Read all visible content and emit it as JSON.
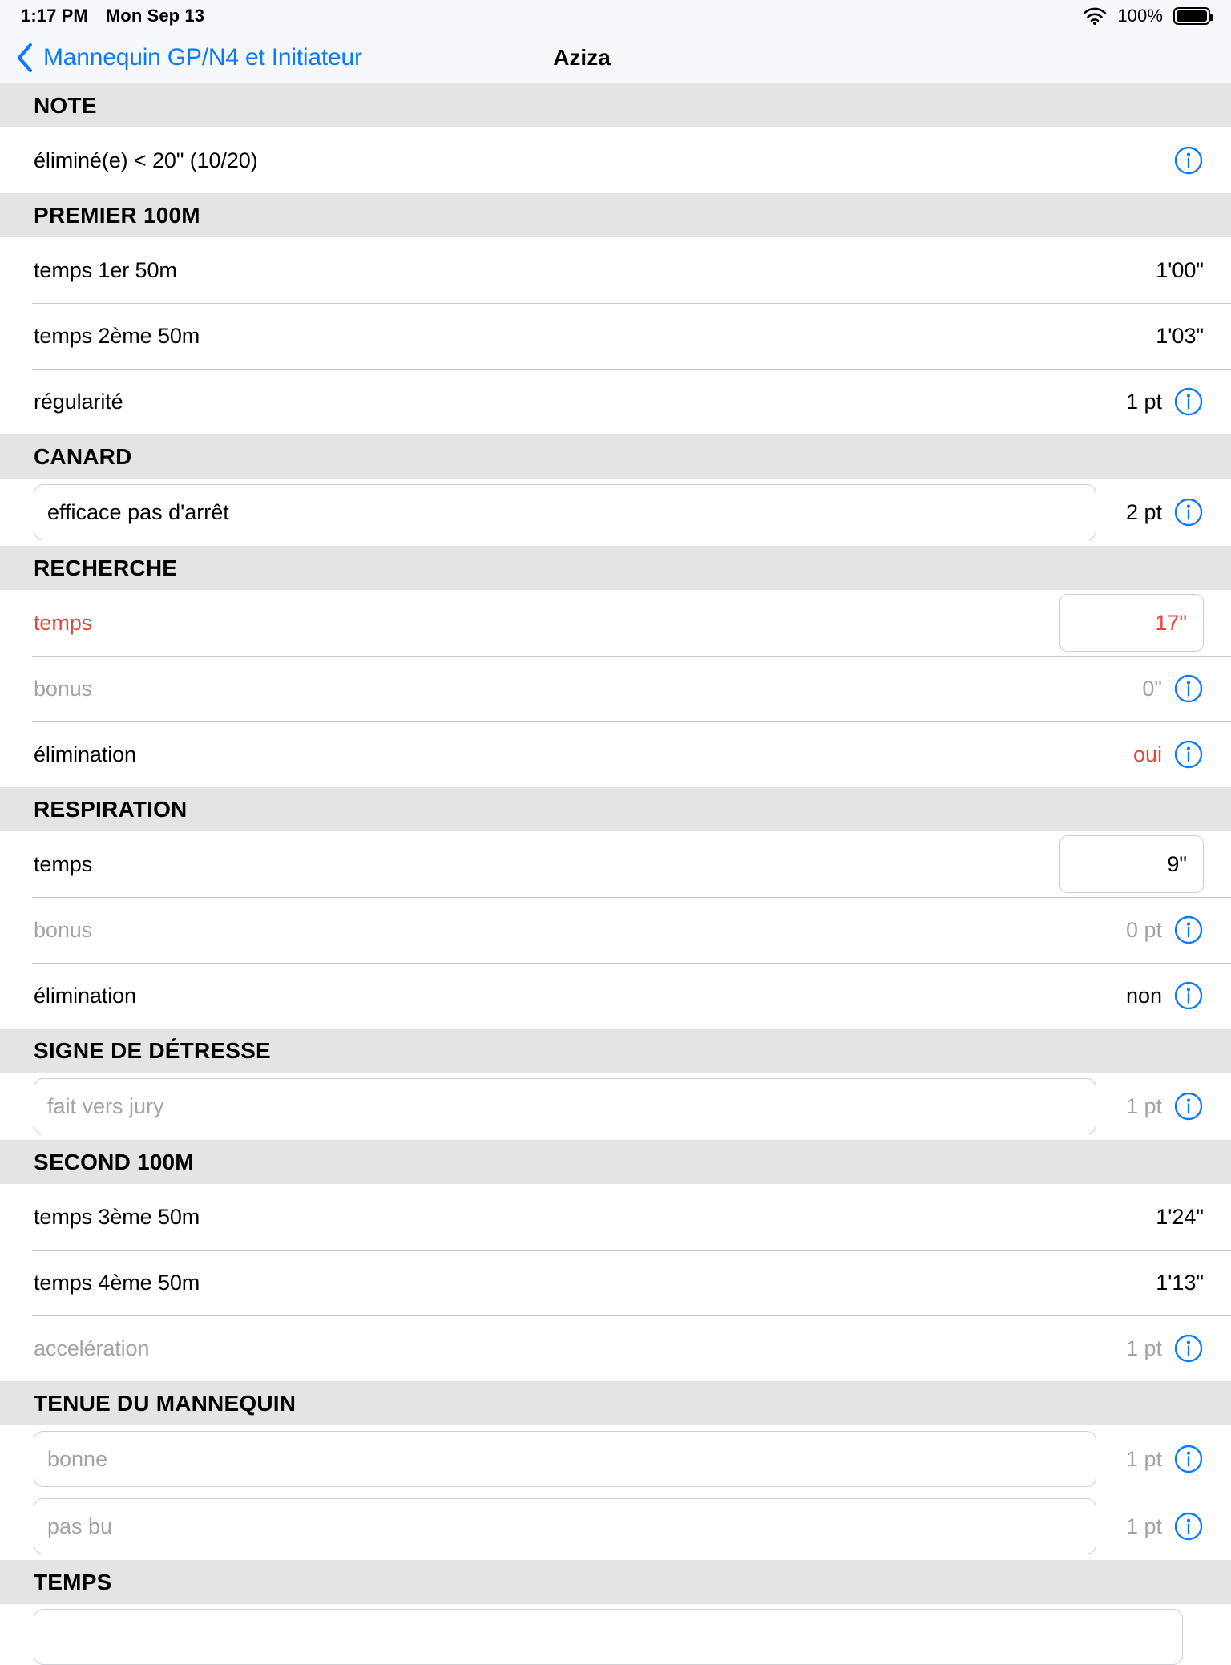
{
  "status_bar": {
    "time": "1:17 PM",
    "date": "Mon Sep 13",
    "battery_percent": "100%",
    "wifi_icon": "wifi-icon",
    "battery_icon": "battery-full-icon"
  },
  "nav": {
    "back_icon": "chevron-left-icon",
    "back_label": "Mannequin GP/N4 et Initiateur",
    "title": "Aziza"
  },
  "colors": {
    "accent_blue": "#0a7bff",
    "alert_red": "#ef4236",
    "dim_gray": "#a3a3a8",
    "section_bg": "#e4e4e6",
    "separator": "#c8c7cc"
  },
  "sections": [
    {
      "header": "NOTE",
      "rows": [
        {
          "label": "éliminé(e) < 20\"  (10/20)",
          "value": "",
          "info": true
        }
      ]
    },
    {
      "header": "PREMIER 100M",
      "rows": [
        {
          "label": "temps 1er 50m",
          "value": "1'00\"",
          "info": false
        },
        {
          "label": "temps 2ème 50m",
          "value": "1'03\"",
          "info": false
        },
        {
          "label": "régularité",
          "value": "1 pt",
          "info": true
        }
      ]
    },
    {
      "header": "CANARD",
      "rows": [
        {
          "field_value": "efficace pas d'arrêt",
          "field_is_placeholder": false,
          "value": "2 pt",
          "info": true
        }
      ]
    },
    {
      "header": "RECHERCHE",
      "rows": [
        {
          "label": "temps",
          "box_value": "17\"",
          "label_style": "red",
          "box_style": "red",
          "info": false
        },
        {
          "label": "bonus",
          "value": "0\"",
          "label_style": "dim",
          "value_style": "dim",
          "info": true
        },
        {
          "label": "élimination",
          "value": "oui",
          "label_style": "",
          "value_style": "red",
          "info": true
        }
      ]
    },
    {
      "header": "RESPIRATION",
      "rows": [
        {
          "label": "temps",
          "box_value": "9\"",
          "label_style": "",
          "box_style": "",
          "info": false
        },
        {
          "label": "bonus",
          "value": "0 pt",
          "label_style": "dim",
          "value_style": "dim",
          "info": true
        },
        {
          "label": "élimination",
          "value": "non",
          "label_style": "",
          "value_style": "",
          "info": true
        }
      ]
    },
    {
      "header": "SIGNE DE DÉTRESSE",
      "rows": [
        {
          "field_value": "fait vers jury",
          "field_is_placeholder": true,
          "value": "1 pt",
          "value_style": "dim",
          "info": true
        }
      ]
    },
    {
      "header": "SECOND 100M",
      "rows": [
        {
          "label": "temps 3ème 50m",
          "value": "1'24\"",
          "info": false
        },
        {
          "label": "temps 4ème 50m",
          "value": "1'13\"",
          "info": false
        },
        {
          "label": "accelération",
          "value": "1 pt",
          "label_style": "dim",
          "value_style": "dim",
          "info": true
        }
      ]
    },
    {
      "header": "TENUE DU MANNEQUIN",
      "rows": [
        {
          "field_value": "bonne",
          "field_is_placeholder": true,
          "value": "1 pt",
          "value_style": "dim",
          "info": true
        },
        {
          "field_value": "pas bu",
          "field_is_placeholder": true,
          "value": "1 pt",
          "value_style": "dim",
          "info": true
        }
      ]
    },
    {
      "header": "TEMPS",
      "rows": []
    }
  ]
}
